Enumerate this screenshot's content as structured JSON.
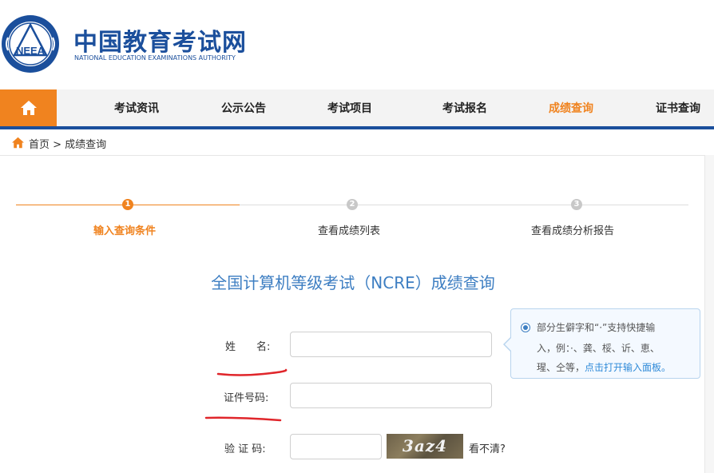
{
  "header": {
    "brand_cn": "中国教育考试网",
    "brand_en": "NATIONAL EDUCATION EXAMINATIONS AUTHORITY",
    "logo_text": "NEEA",
    "logo_icon": "neea-emblem-icon"
  },
  "nav": {
    "home_icon": "home-icon",
    "items": [
      {
        "label": "考试资讯"
      },
      {
        "label": "公示公告"
      },
      {
        "label": "考试项目"
      },
      {
        "label": "考试报名"
      },
      {
        "label": "成绩查询"
      },
      {
        "label": "证书查询"
      }
    ],
    "active_index": 4
  },
  "breadcrumb": {
    "text": "首页 > 成绩查询",
    "icon": "home-icon"
  },
  "steps": [
    {
      "num": "1",
      "label": "输入查询条件"
    },
    {
      "num": "2",
      "label": "查看成绩列表"
    },
    {
      "num": "3",
      "label": "查看成绩分析报告"
    }
  ],
  "form": {
    "title": "全国计算机等级考试（NCRE）成绩查询",
    "name_label": "姓　　名:",
    "id_label": "证件号码:",
    "captcha_label": "验 证 码:",
    "captcha_image_text": "3az4",
    "captcha_refresh": "看不清?",
    "name_value": "",
    "id_value": "",
    "captcha_value": ""
  },
  "tip": {
    "line1": "部分生僻字和“·”支持快捷输",
    "line2": "入，例：·、龚、桵、䜣、恵、",
    "line3_text": "瑆、仝等，",
    "line3_link": "点击打开输入面板。"
  },
  "colors": {
    "brand_blue": "#1b4f9c",
    "accent_orange": "#f0831f",
    "title_blue": "#3d7ec2",
    "link_blue": "#2f8ad8",
    "annotation_red": "#e0262b"
  }
}
